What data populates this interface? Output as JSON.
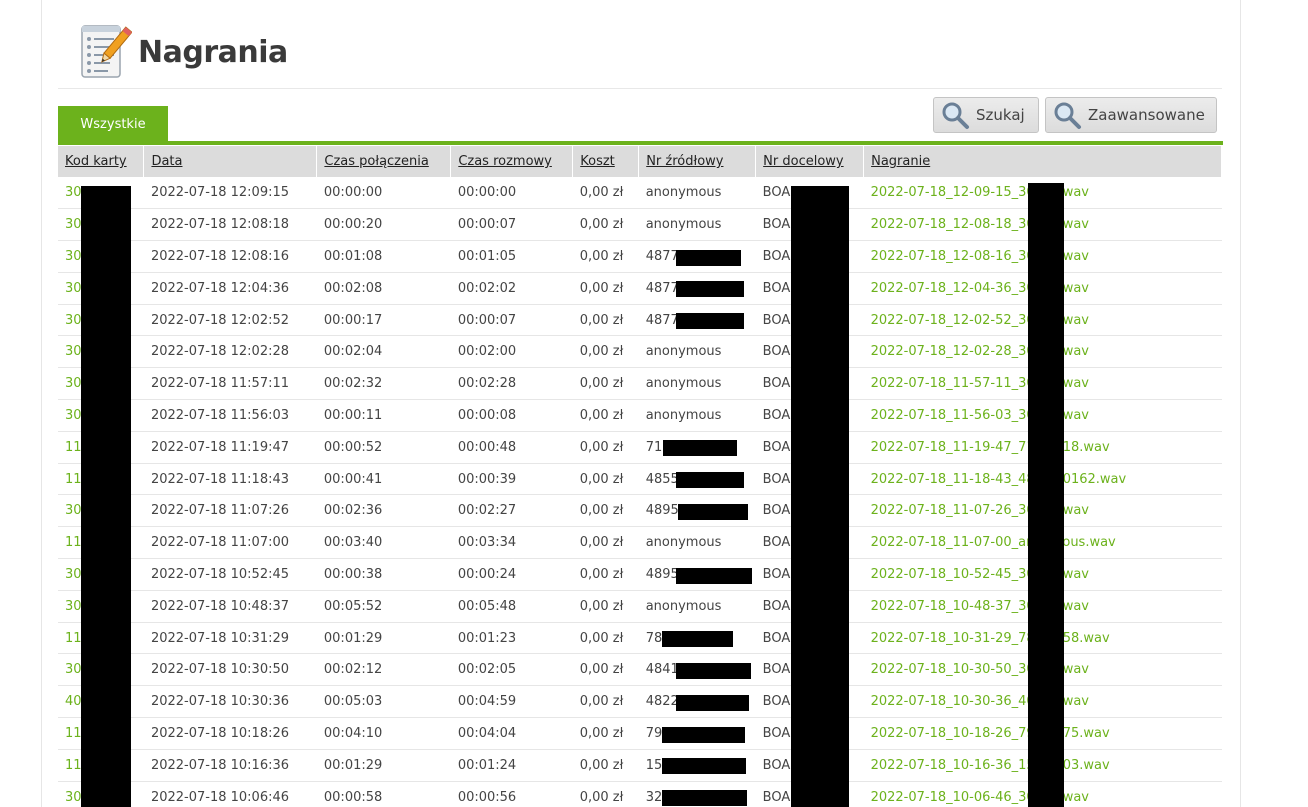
{
  "page": {
    "title": "Nagrania",
    "icon": "notepad-pencil-icon"
  },
  "tabs": [
    {
      "label": "Wszystkie",
      "active": true
    }
  ],
  "toolbar": {
    "search_label": "Szukaj",
    "advanced_label": "Zaawansowane",
    "icon": "magnifier-icon"
  },
  "colors": {
    "accent": "#6cb21c",
    "header_bg": "#dcdcdc"
  },
  "table": {
    "columns": [
      "Kod karty",
      "Data",
      "Czas połączenia",
      "Czas rozmowy",
      "Koszt",
      "Nr źródłowy",
      "Nr docelowy",
      "Nagranie"
    ],
    "rows": [
      {
        "card": "30",
        "date": "2022-07-18 12:09:15",
        "conn": "00:00:00",
        "talk": "00:00:00",
        "cost": "0,00 zł",
        "src": "anonymous",
        "dst": "BOA",
        "rec_pre": "2022-07-18_12-09-15_30",
        "rec_post": "wav"
      },
      {
        "card": "30",
        "date": "2022-07-18 12:08:18",
        "conn": "00:00:20",
        "talk": "00:00:07",
        "cost": "0,00 zł",
        "src": "anonymous",
        "dst": "BOA",
        "rec_pre": "2022-07-18_12-08-18_30",
        "rec_post": "wav"
      },
      {
        "card": "30",
        "date": "2022-07-18 12:08:16",
        "conn": "00:01:08",
        "talk": "00:01:05",
        "cost": "0,00 zł",
        "src": "4877",
        "dst": "BOA",
        "rec_pre": "2022-07-18_12-08-16_30",
        "rec_post": "wav"
      },
      {
        "card": "30",
        "date": "2022-07-18 12:04:36",
        "conn": "00:02:08",
        "talk": "00:02:02",
        "cost": "0,00 zł",
        "src": "4877",
        "dst": "BOA",
        "rec_pre": "2022-07-18_12-04-36_30",
        "rec_post": "wav"
      },
      {
        "card": "30",
        "date": "2022-07-18 12:02:52",
        "conn": "00:00:17",
        "talk": "00:00:07",
        "cost": "0,00 zł",
        "src": "4877",
        "dst": "BOA",
        "rec_pre": "2022-07-18_12-02-52_30",
        "rec_post": "wav"
      },
      {
        "card": "30",
        "date": "2022-07-18 12:02:28",
        "conn": "00:02:04",
        "talk": "00:02:00",
        "cost": "0,00 zł",
        "src": "anonymous",
        "dst": "BOA",
        "rec_pre": "2022-07-18_12-02-28_30",
        "rec_post": "wav"
      },
      {
        "card": "30",
        "date": "2022-07-18 11:57:11",
        "conn": "00:02:32",
        "talk": "00:02:28",
        "cost": "0,00 zł",
        "src": "anonymous",
        "dst": "BOA",
        "rec_pre": "2022-07-18_11-57-11_30",
        "rec_post": "wav"
      },
      {
        "card": "30",
        "date": "2022-07-18 11:56:03",
        "conn": "00:00:11",
        "talk": "00:00:08",
        "cost": "0,00 zł",
        "src": "anonymous",
        "dst": "BOA",
        "rec_pre": "2022-07-18_11-56-03_30",
        "rec_post": "wav"
      },
      {
        "card": "11",
        "date": "2022-07-18 11:19:47",
        "conn": "00:00:52",
        "talk": "00:00:48",
        "cost": "0,00 zł",
        "src": "71",
        "dst": "BOA",
        "rec_pre": "2022-07-18_11-19-47_71",
        "rec_post": "18.wav"
      },
      {
        "card": "11",
        "date": "2022-07-18 11:18:43",
        "conn": "00:00:41",
        "talk": "00:00:39",
        "cost": "0,00 zł",
        "src": "4855",
        "dst": "BOA",
        "rec_pre": "2022-07-18_11-18-43_48",
        "rec_post": "0162.wav"
      },
      {
        "card": "30",
        "date": "2022-07-18 11:07:26",
        "conn": "00:02:36",
        "talk": "00:02:27",
        "cost": "0,00 zł",
        "src": "4895",
        "dst": "BOA",
        "rec_pre": "2022-07-18_11-07-26_30",
        "rec_post": "wav"
      },
      {
        "card": "11",
        "date": "2022-07-18 11:07:00",
        "conn": "00:03:40",
        "talk": "00:03:34",
        "cost": "0,00 zł",
        "src": "anonymous",
        "dst": "BOA",
        "rec_pre": "2022-07-18_11-07-00_an",
        "rec_post": "ous.wav"
      },
      {
        "card": "30",
        "date": "2022-07-18 10:52:45",
        "conn": "00:00:38",
        "talk": "00:00:24",
        "cost": "0,00 zł",
        "src": "4895",
        "dst": "BOA",
        "rec_pre": "2022-07-18_10-52-45_30",
        "rec_post": "wav"
      },
      {
        "card": "30",
        "date": "2022-07-18 10:48:37",
        "conn": "00:05:52",
        "talk": "00:05:48",
        "cost": "0,00 zł",
        "src": "anonymous",
        "dst": "BOA",
        "rec_pre": "2022-07-18_10-48-37_30",
        "rec_post": "wav"
      },
      {
        "card": "11",
        "date": "2022-07-18 10:31:29",
        "conn": "00:01:29",
        "talk": "00:01:23",
        "cost": "0,00 zł",
        "src": "78",
        "dst": "BOA",
        "rec_pre": "2022-07-18_10-31-29_78",
        "rec_post": "58.wav"
      },
      {
        "card": "30",
        "date": "2022-07-18 10:30:50",
        "conn": "00:02:12",
        "talk": "00:02:05",
        "cost": "0,00 zł",
        "src": "4841",
        "dst": "BOA",
        "rec_pre": "2022-07-18_10-30-50_30",
        "rec_post": "wav"
      },
      {
        "card": "40",
        "date": "2022-07-18 10:30:36",
        "conn": "00:05:03",
        "talk": "00:04:59",
        "cost": "0,00 zł",
        "src": "4822",
        "dst": "BOA",
        "rec_pre": "2022-07-18_10-30-36_40",
        "rec_post": "wav"
      },
      {
        "card": "11",
        "date": "2022-07-18 10:18:26",
        "conn": "00:04:10",
        "talk": "00:04:04",
        "cost": "0,00 zł",
        "src": "79",
        "dst": "BOA",
        "rec_pre": "2022-07-18_10-18-26_79",
        "rec_post": "75.wav"
      },
      {
        "card": "11",
        "date": "2022-07-18 10:16:36",
        "conn": "00:01:29",
        "talk": "00:01:24",
        "cost": "0,00 zł",
        "src": "15",
        "dst": "BOA",
        "rec_pre": "2022-07-18_10-16-36_15",
        "rec_post": "03.wav"
      },
      {
        "card": "30",
        "date": "2022-07-18 10:06:46",
        "conn": "00:00:58",
        "talk": "00:00:56",
        "cost": "0,00 zł",
        "src": "32",
        "dst": "BOA",
        "rec_pre": "2022-07-18_10-06-46_30",
        "rec_post": "wav"
      }
    ]
  }
}
